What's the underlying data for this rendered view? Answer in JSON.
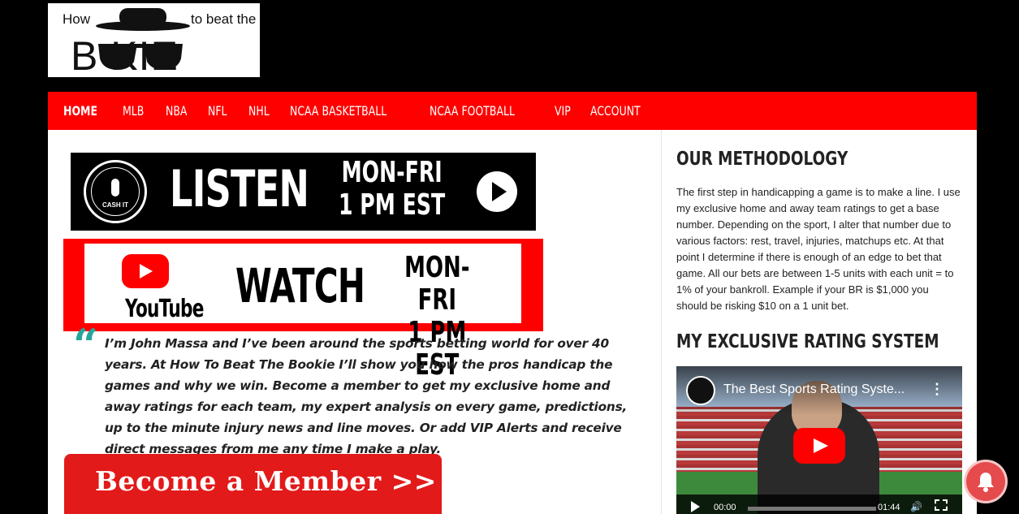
{
  "logo": {
    "line1_left": "How",
    "line1_right": "to beat the",
    "line2": "B  KIE"
  },
  "nav": {
    "items": [
      {
        "label": "HOME"
      },
      {
        "label": "MLB"
      },
      {
        "label": "NBA"
      },
      {
        "label": "NFL"
      },
      {
        "label": "NHL"
      },
      {
        "label": "NCAA BASKETBALL"
      },
      {
        "label": "NCAA FOOTBALL"
      },
      {
        "label": "VIP"
      },
      {
        "label": "ACCOUNT"
      }
    ],
    "active": "HOME",
    "background": "#ff0000"
  },
  "listen_banner": {
    "label": "LISTEN",
    "schedule_line1": "MON-FRI",
    "schedule_line2": "1 PM EST",
    "badge_top": "HOW TO BEAT THE BOOKIE",
    "badge_est": "ESTD 2023",
    "badge_name": "CASH IT",
    "badge_sub": "PODCAST"
  },
  "watch_banner": {
    "platform": "YouTube",
    "label": "WATCH",
    "schedule_line1": "MON-FRI",
    "schedule_line2": "1 PM EST"
  },
  "intro_quote": "I’m John Massa and I’ve been around the sports betting world for over 40 years. At How To Beat The Bookie I’ll show you how the pros handicap the games and why we win. Become a member to get my exclusive home and away ratings for each team, my expert analysis on every game, predictions, up to the minute injury news and line moves. Or add VIP Alerts and receive direct messages from me any time I make a play.",
  "cta": {
    "label": "Become a Member >>"
  },
  "sidebar": {
    "methodology_heading": "OUR METHODOLOGY",
    "methodology_text": "The first step in handicapping a game is to make a line. I use my exclusive home and away team ratings to get a base number. Depending on the sport, I alter that number due to various factors: rest, travel, injuries, matchups etc. At that point I determine if there is enough of an edge to bet that game. All our bets are between 1-5 units with each unit = to 1% of your bankroll. Example if your BR is $1,000 you should be risking $10 on a 1 unit bet.",
    "rating_heading": "MY EXCLUSIVE RATING SYSTEM",
    "video": {
      "title": "The Best Sports Rating Syste...",
      "current_time": "00:00",
      "duration": "01:44"
    }
  },
  "colors": {
    "accent": "#ff0000",
    "quote_mark": "#26a69a",
    "cta": "#e21a1a",
    "bell": "#e54b4d"
  }
}
